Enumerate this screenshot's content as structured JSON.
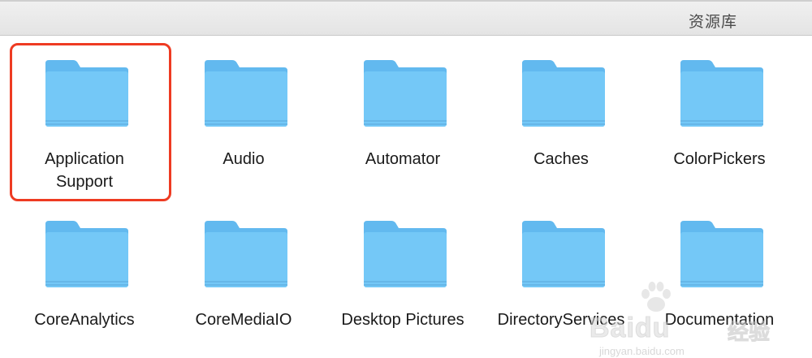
{
  "window": {
    "title": "资源库"
  },
  "items": [
    {
      "label": "Application\nSupport",
      "selected": true
    },
    {
      "label": "Audio"
    },
    {
      "label": "Automator"
    },
    {
      "label": "Caches"
    },
    {
      "label": "ColorPickers"
    },
    {
      "label": "CoreAnalytics"
    },
    {
      "label": "CoreMediaIO"
    },
    {
      "label": "Desktop Pictures"
    },
    {
      "label": "DirectoryServices"
    },
    {
      "label": "Documentation"
    }
  ],
  "icon": "folder-icon",
  "colors": {
    "folder_body": "#74c8f7",
    "folder_tab": "#62b9ef",
    "selection": "#ee3b22"
  },
  "watermark": {
    "brand": "Baidu",
    "cn": "经验",
    "url": "jingyan.baidu.com"
  }
}
